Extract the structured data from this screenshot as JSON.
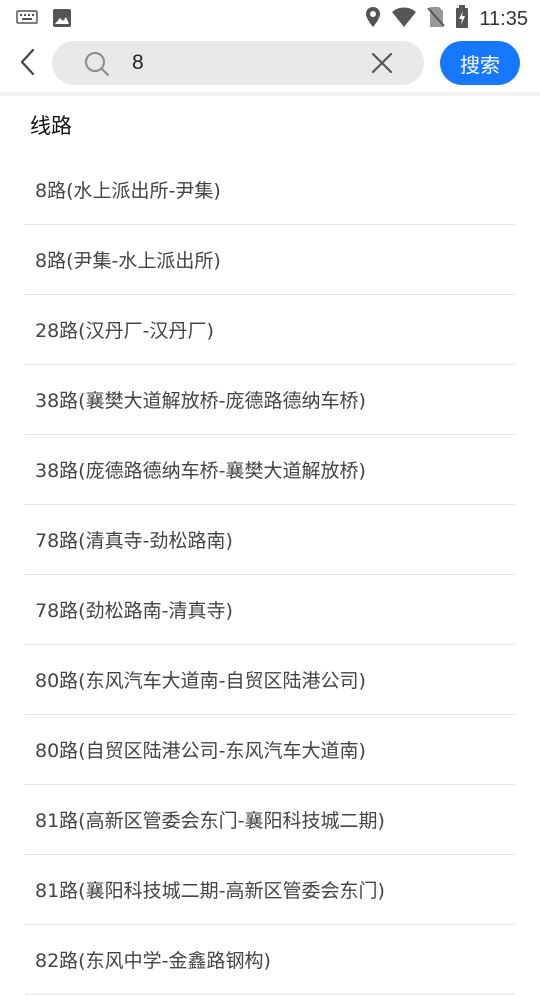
{
  "status_bar": {
    "time": "11:35",
    "icons": [
      "keyboard-icon",
      "image-icon",
      "location-icon",
      "wifi-icon",
      "no-sim-icon",
      "battery-charging-icon"
    ]
  },
  "search": {
    "back_icon": "chevron-left-icon",
    "search_icon": "search-icon",
    "query": "8",
    "clear_icon": "close-icon",
    "submit_label": "搜索",
    "accent_color": "#1677ff"
  },
  "results": {
    "section_title": "线路",
    "routes": [
      "8路(水上派出所-尹集)",
      "8路(尹集-水上派出所)",
      "28路(汉丹厂-汉丹厂)",
      "38路(襄樊大道解放桥-庞德路德纳车桥)",
      "38路(庞德路德纳车桥-襄樊大道解放桥)",
      "78路(清真寺-劲松路南)",
      "78路(劲松路南-清真寺)",
      "80路(东风汽车大道南-自贸区陆港公司)",
      "80路(自贸区陆港公司-东风汽车大道南)",
      "81路(高新区管委会东门-襄阳科技城二期)",
      "81路(襄阳科技城二期-高新区管委会东门)",
      "82路(东风中学-金鑫路钢构)"
    ]
  }
}
